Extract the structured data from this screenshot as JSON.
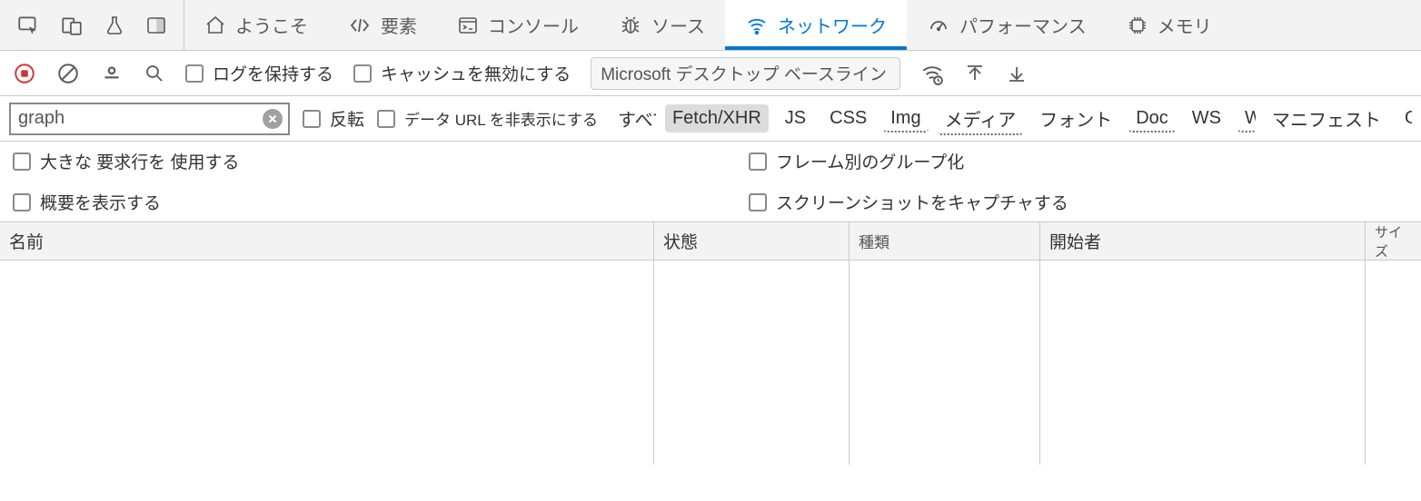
{
  "tabs": {
    "welcome": "ようこそ",
    "elements": "要素",
    "console": "コンソール",
    "sources": "ソース",
    "network": "ネットワーク",
    "performance": "パフォーマンス",
    "memory": "メモリ"
  },
  "toolbar": {
    "preserve_log": "ログを保持する",
    "disable_cache": "キャッシュを無効にする",
    "throttle_label": "Microsoft デスクトップ ベースライン"
  },
  "filter": {
    "value": "graph",
    "invert": "反転",
    "hide_data_urls": "データ URL を非表示にする",
    "types": {
      "all": "すべて",
      "fetch_xhr": "Fetch/XHR",
      "js": "JS",
      "css": "CSS",
      "img": "Img",
      "media": "メディア",
      "font": "フォント",
      "doc": "Doc",
      "ws": "WS",
      "wasm": "Wasm",
      "manifest": "マニフェスト",
      "other": "Other"
    }
  },
  "options": {
    "large_rows": "大きな 要求行を 使用する",
    "group_by_frame": "フレーム別のグループ化",
    "show_overview": "概要を表示する",
    "capture_screenshots": "スクリーンショットをキャプチャする"
  },
  "columns": {
    "name": "名前",
    "status": "状態",
    "type": "種類",
    "initiator": "開始者",
    "size": "サイズ"
  }
}
